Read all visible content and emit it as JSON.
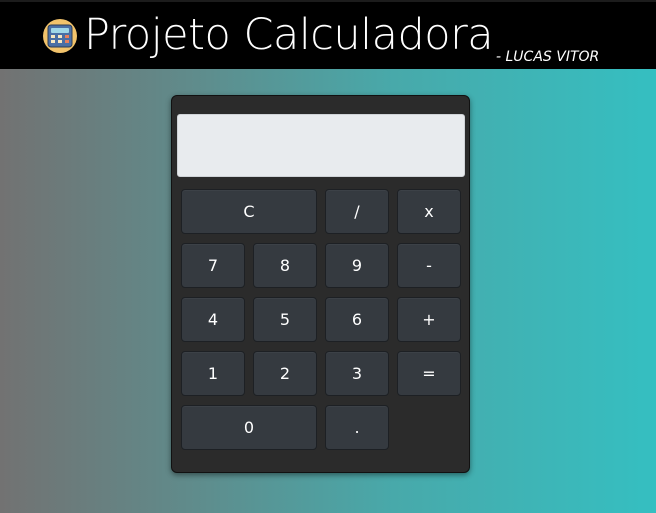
{
  "header": {
    "title": "Projeto Calculadora",
    "subtitle": "- LUCAS VITOR",
    "logo_icon": "calculator-icon"
  },
  "calculator": {
    "display_value": "",
    "buttons": {
      "clear": "C",
      "divide": "/",
      "multiply": "x",
      "seven": "7",
      "eight": "8",
      "nine": "9",
      "minus": "-",
      "four": "4",
      "five": "5",
      "six": "6",
      "plus": "+",
      "one": "1",
      "two": "2",
      "three": "3",
      "equals": "=",
      "zero": "0",
      "dot": "."
    }
  },
  "colors": {
    "header_bg": "#000000",
    "calculator_bg": "#2b2b2b",
    "button_bg": "#353a40",
    "display_bg": "#e8ebee",
    "gradient_start": "#727272",
    "gradient_end": "#35bfc1"
  }
}
